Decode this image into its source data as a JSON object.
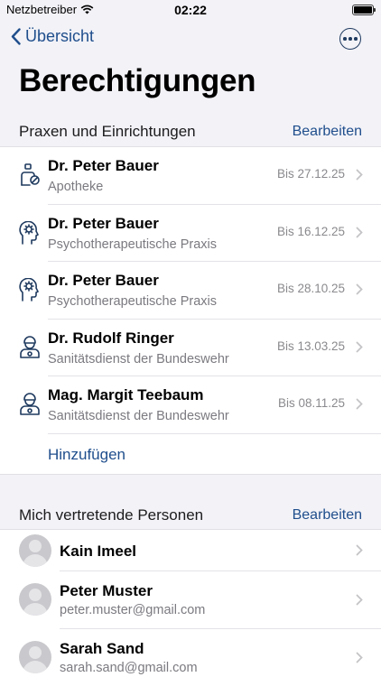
{
  "status_bar": {
    "carrier": "Netzbetreiber",
    "time": "02:22"
  },
  "nav": {
    "back_label": "Übersicht"
  },
  "page_title": "Berechtigungen",
  "section_practices": {
    "title": "Praxen und Einrichtungen",
    "edit_label": "Bearbeiten",
    "items": [
      {
        "name": "Dr. Peter Bauer",
        "type": "Apotheke",
        "date": "Bis 27.12.25",
        "icon": "pharmacist-icon"
      },
      {
        "name": "Dr. Peter Bauer",
        "type": "Psychotherapeutische Praxis",
        "date": "Bis 16.12.25",
        "icon": "brain-head-icon"
      },
      {
        "name": "Dr. Peter Bauer",
        "type": "Psychotherapeutische Praxis",
        "date": "Bis 28.10.25",
        "icon": "brain-head-icon"
      },
      {
        "name": "Dr. Rudolf Ringer",
        "type": "Sanitätsdienst der Bundeswehr",
        "date": "Bis 13.03.25",
        "icon": "medic-icon"
      },
      {
        "name": "Mag. Margit Teebaum",
        "type": "Sanitätsdienst der Bundeswehr",
        "date": "Bis 08.11.25",
        "icon": "medic-icon"
      }
    ],
    "add_label": "Hinzufügen"
  },
  "section_persons": {
    "title": "Mich vertretende Personen",
    "edit_label": "Bearbeiten",
    "items": [
      {
        "name": "Kain Imeel",
        "email": ""
      },
      {
        "name": "Peter Muster",
        "email": "peter.muster@gmail.com"
      },
      {
        "name": "Sarah Sand",
        "email": "sarah.sand@gmail.com"
      }
    ]
  },
  "colors": {
    "accent": "#1f4e8c",
    "background": "#f2f2f7",
    "icon": "#1f3a5f"
  }
}
